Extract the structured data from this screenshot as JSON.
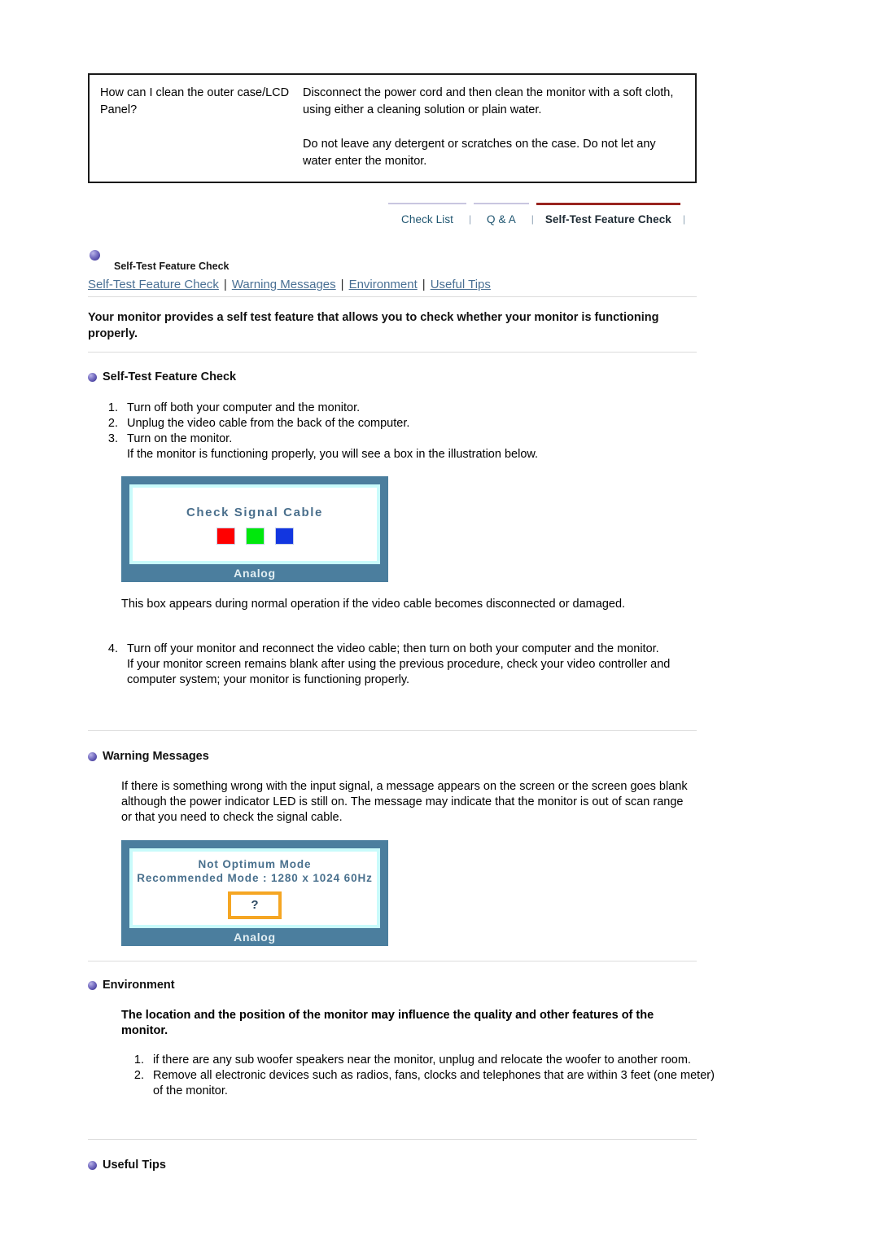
{
  "faq": {
    "question": "How can I clean the outer case/LCD Panel?",
    "answer_paragraphs": [
      "Disconnect the power cord and then clean the monitor with a soft cloth, using either a cleaning solution or plain water.",
      "Do not leave any detergent or scratches on the case. Do not let any water enter the monitor."
    ]
  },
  "tabs": [
    {
      "label": "Check List",
      "active": false
    },
    {
      "label": "Q & A",
      "active": false
    },
    {
      "label": "Self-Test Feature Check",
      "active": true
    }
  ],
  "breadcrumb": {
    "bullet_icon": "purple-orb-icon",
    "label": "Self-Test Feature Check"
  },
  "subnav": {
    "links": [
      "Self-Test Feature Check",
      "Warning Messages",
      "Environment",
      "Useful Tips"
    ],
    "separator": "|"
  },
  "intro": "Your monitor provides a self test feature that allows you to check whether your monitor is functioning properly.",
  "sections": {
    "self_test": {
      "heading": "Self-Test Feature Check",
      "bullet_icon": "purple-orb-icon",
      "steps": [
        {
          "num": "1.",
          "text": "Turn off both your computer and the monitor.",
          "cont": ""
        },
        {
          "num": "2.",
          "text": "Unplug the video cable from the back of the computer.",
          "cont": ""
        },
        {
          "num": "3.",
          "text": "Turn on the monitor.",
          "cont": "If the monitor is functioning properly, you will see a box in the illustration below."
        }
      ],
      "after_image_note": "This box appears during normal operation if the video cable becomes disconnected or damaged.",
      "step4": {
        "num": "4.",
        "text": "Turn off your monitor and reconnect the video cable; then turn on both your computer and the monitor.",
        "cont": "If your monitor screen remains blank after using the previous procedure, check your video controller and computer system; your monitor is functioning properly."
      },
      "osd": {
        "title": "Check Signal Cable",
        "colors": [
          "#ff0000",
          "#00e80c",
          "#1236e0"
        ],
        "footer": "Analog"
      }
    },
    "warning_messages": {
      "heading": "Warning Messages",
      "bullet_icon": "purple-orb-icon",
      "body": "If there is something wrong with the input signal, a message appears on the screen or the screen goes blank although the power indicator LED is still on. The message may indicate that the monitor is out of scan range or that you need to check the signal cable.",
      "osd": {
        "line1": "Not Optimum Mode",
        "line2": "Recommended Mode : 1280 x 1024  60Hz",
        "question_mark": "?",
        "footer": "Analog"
      }
    },
    "environment": {
      "heading": "Environment",
      "bullet_icon": "purple-orb-icon",
      "lead": "The location and the position of the monitor may influence the quality and other features of the monitor.",
      "items": [
        {
          "num": "1.",
          "text": "if there are any sub woofer speakers near the monitor, unplug and relocate the woofer to another room."
        },
        {
          "num": "2.",
          "text": "Remove all electronic devices such as radios, fans, clocks and telephones that are within 3 feet (one meter) of the monitor."
        }
      ]
    },
    "useful_tips": {
      "heading": "Useful Tips",
      "bullet_icon": "purple-orb-icon"
    }
  },
  "colors": {
    "active_tab_border": "#99241f",
    "inactive_tab_border": "#c9c6e0",
    "link": "#4a7094",
    "monitor_frame": "#4b7e9e",
    "monitor_inner_glow": "#c9fbfb",
    "qbox_border": "#f5a623",
    "orb": "#4b43a0"
  }
}
